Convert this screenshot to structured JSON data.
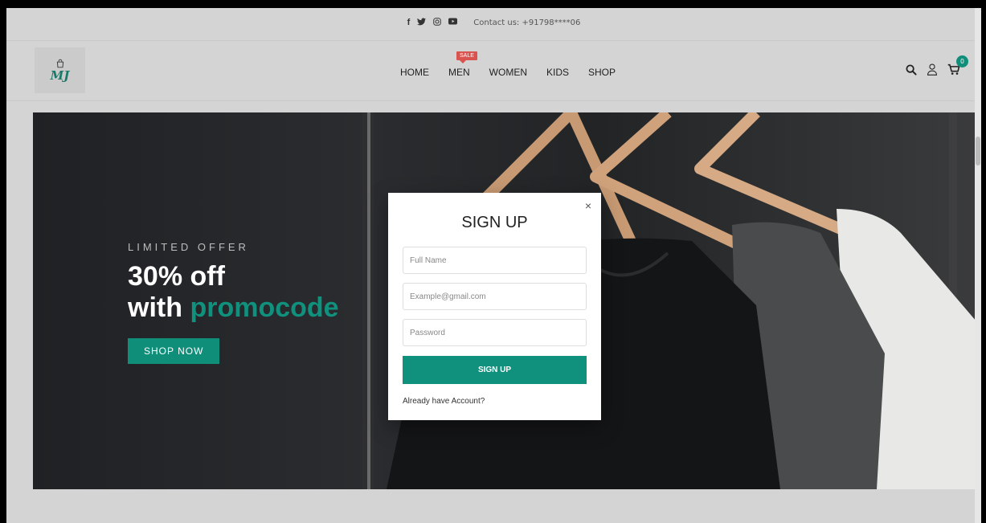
{
  "topbar": {
    "social": [
      {
        "name": "facebook-icon",
        "glyph": "f"
      },
      {
        "name": "twitter-icon",
        "glyph": "🐦"
      },
      {
        "name": "instagram-icon",
        "glyph": "◎"
      },
      {
        "name": "youtube-icon",
        "glyph": "▶"
      }
    ],
    "contact": "Contact us: +91798****06"
  },
  "nav": {
    "items": [
      "HOME",
      "MEN",
      "WOMEN",
      "KIDS",
      "SHOP"
    ],
    "sale_badge": "SALE"
  },
  "cart": {
    "count": "0"
  },
  "hero": {
    "eyebrow": "LIMITED OFFER",
    "line1": "30% off",
    "line2_prefix": "with ",
    "line2_accent": "promocode",
    "button": "SHOP NOW"
  },
  "signup": {
    "title": "SIGN UP",
    "close": "×",
    "name_placeholder": "Full Name",
    "email_placeholder": "Example@gmail.com",
    "password_placeholder": "Password",
    "submit": "SIGN UP",
    "login_link": "Already have Account?"
  },
  "colors": {
    "accent": "#0f8f7a",
    "sale": "#d9534f"
  }
}
